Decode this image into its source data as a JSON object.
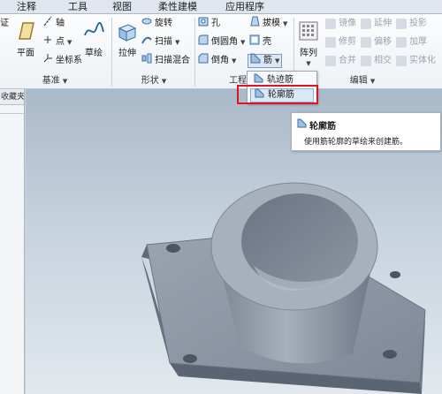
{
  "tabs": [
    {
      "label": "注释",
      "selected": false
    },
    {
      "label": "工具",
      "selected": false
    },
    {
      "label": "视图",
      "selected": false
    },
    {
      "label": "柔性建模",
      "selected": false
    },
    {
      "label": "应用程序",
      "selected": false
    }
  ],
  "ribbon": {
    "datum": {
      "partial_label": "证",
      "plane": "平面",
      "axis": "轴",
      "point": "点",
      "csys": "坐标系",
      "sketch": "草绘",
      "group_label": "基准"
    },
    "shapes": {
      "extrude": "拉伸",
      "revolve": "旋转",
      "sweep": "扫描",
      "swept_blend": "扫描混合",
      "group_label": "形状"
    },
    "engineering": {
      "hole": "孔",
      "round": "倒圆角",
      "chamfer": "倒角",
      "draft": "拔模",
      "shell": "壳",
      "rib": "筋",
      "group_label": "工程"
    },
    "editing": {
      "pattern": "阵列",
      "mirror": "镜像",
      "extend": "延伸",
      "project": "投影",
      "trim": "修剪",
      "offset": "偏移",
      "thicken": "加厚",
      "merge": "合并",
      "intersect": "相交",
      "solidify": "实体化",
      "group_label": "编辑"
    }
  },
  "rib_menu": {
    "items": [
      "轨迹筋",
      "轮廓筋"
    ],
    "highlighted": "轮廓筋"
  },
  "tooltip": {
    "title": "轮廓筋",
    "description": "使用筋轮廓的草绘来创建筋。"
  },
  "left_panel": {
    "header": "收藏夹"
  },
  "colors": {
    "accent_red": "#e0141e",
    "model_gray": "#8e98a6",
    "ribbon_bg": "#f4f7fa"
  }
}
